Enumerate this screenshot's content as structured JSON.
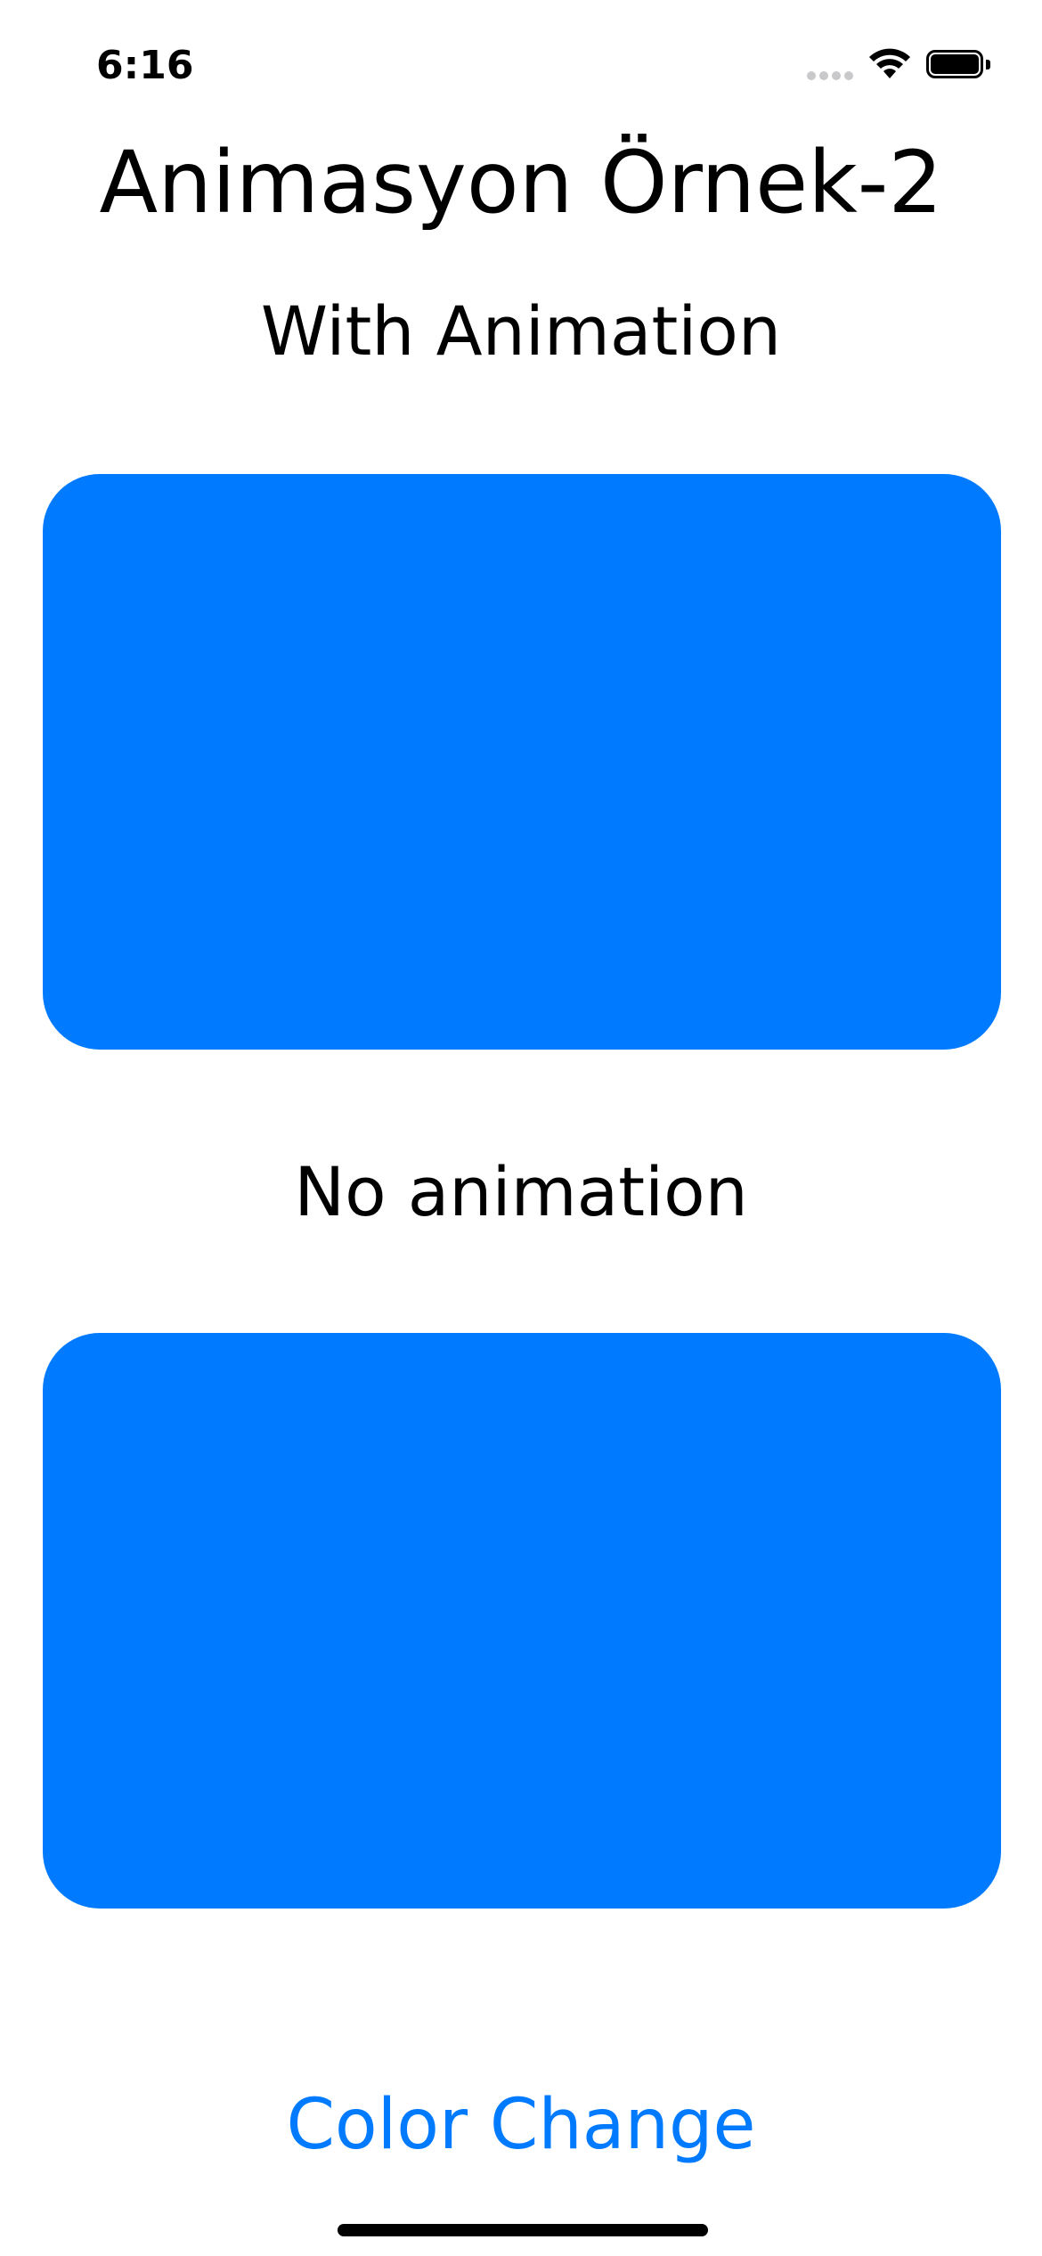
{
  "status_bar": {
    "time": "6:16",
    "icons": [
      "cellular-signal-icon",
      "wifi-icon",
      "battery-icon"
    ]
  },
  "screen": {
    "title": "Animasyon Örnek-2",
    "with_animation_label": "With Animation",
    "no_animation_label": "No animation",
    "button_label": "Color Change"
  },
  "colors": {
    "box_with_animation": "#007AFF",
    "box_no_animation": "#007AFF",
    "button_text": "#007AFF",
    "background": "#FFFFFF",
    "text": "#000000"
  }
}
